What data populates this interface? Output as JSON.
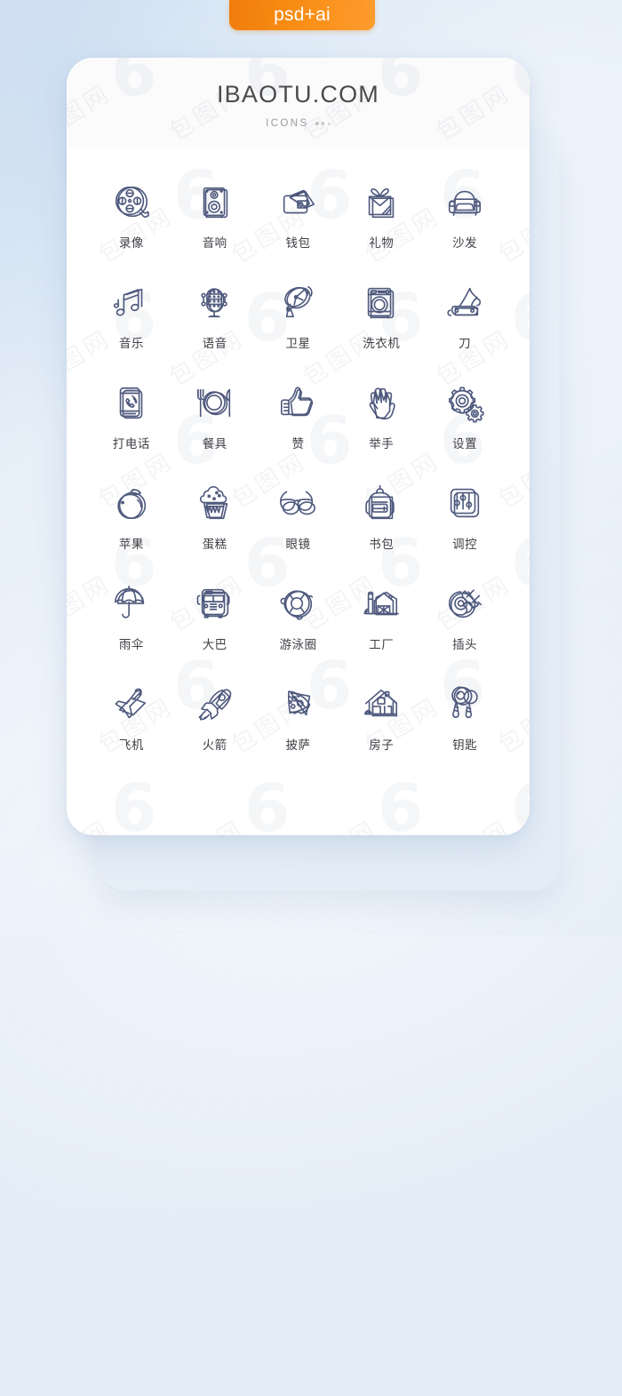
{
  "badge": {
    "label": "psd+ai",
    "color": "#f78c13"
  },
  "card": {
    "brand": "IBAOTU.COM",
    "subtitle": "ICONS",
    "accent": "#4e597d",
    "label_color": "#3f3f46"
  },
  "watermark": {
    "text": "包图网",
    "logo": "6"
  },
  "icons": [
    {
      "label": "录像",
      "icon": "film-reel-icon"
    },
    {
      "label": "音响",
      "icon": "speaker-icon"
    },
    {
      "label": "钱包",
      "icon": "wallet-icon"
    },
    {
      "label": "礼物",
      "icon": "gift-icon"
    },
    {
      "label": "沙发",
      "icon": "sofa-icon"
    },
    {
      "label": "音乐",
      "icon": "music-note-icon"
    },
    {
      "label": "语音",
      "icon": "microphone-icon"
    },
    {
      "label": "卫星",
      "icon": "satellite-dish-icon"
    },
    {
      "label": "洗衣机",
      "icon": "washing-machine-icon"
    },
    {
      "label": "刀",
      "icon": "pocket-knife-icon"
    },
    {
      "label": "打电话",
      "icon": "phone-call-icon"
    },
    {
      "label": "餐具",
      "icon": "cutlery-icon"
    },
    {
      "label": "赞",
      "icon": "thumbs-up-icon"
    },
    {
      "label": "举手",
      "icon": "raised-hand-icon"
    },
    {
      "label": "设置",
      "icon": "gears-icon"
    },
    {
      "label": "苹果",
      "icon": "apple-icon"
    },
    {
      "label": "蛋糕",
      "icon": "cupcake-icon"
    },
    {
      "label": "眼镜",
      "icon": "glasses-icon"
    },
    {
      "label": "书包",
      "icon": "backpack-icon"
    },
    {
      "label": "调控",
      "icon": "sliders-icon"
    },
    {
      "label": "雨伞",
      "icon": "umbrella-icon"
    },
    {
      "label": "大巴",
      "icon": "bus-icon"
    },
    {
      "label": "游泳圈",
      "icon": "swim-ring-icon"
    },
    {
      "label": "工厂",
      "icon": "factory-icon"
    },
    {
      "label": "插头",
      "icon": "plug-icon"
    },
    {
      "label": "飞机",
      "icon": "airplane-icon"
    },
    {
      "label": "火箭",
      "icon": "rocket-icon"
    },
    {
      "label": "披萨",
      "icon": "pizza-icon"
    },
    {
      "label": "房子",
      "icon": "house-icon"
    },
    {
      "label": "钥匙",
      "icon": "keys-icon"
    }
  ]
}
